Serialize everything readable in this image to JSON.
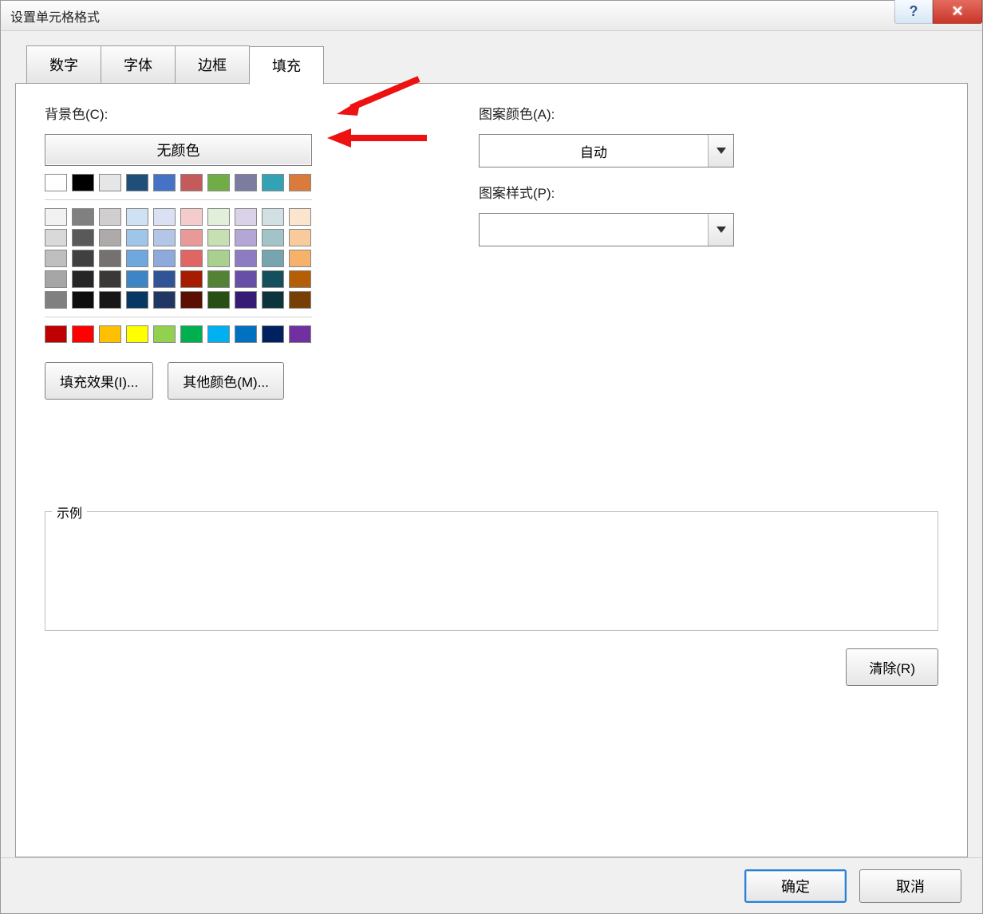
{
  "window": {
    "title": "设置单元格格式"
  },
  "controls": {
    "help_tooltip": "帮助",
    "close_tooltip": "关闭"
  },
  "tabs": [
    {
      "label": "数字",
      "active": false
    },
    {
      "label": "字体",
      "active": false
    },
    {
      "label": "边框",
      "active": false
    },
    {
      "label": "填充",
      "active": true
    }
  ],
  "background": {
    "label": "背景色(C):",
    "no_color_label": "无颜色",
    "theme_row": [
      "#ffffff",
      "#000000",
      "#e7e6e6",
      "#1f4e79",
      "#4472c4",
      "#c55a5a",
      "#70ad47",
      "#7c7ca0",
      "#33a2b5",
      "#d97b3b"
    ],
    "tints": [
      [
        "#f2f2f2",
        "#808080",
        "#d0cece",
        "#cfe2f3",
        "#d9e1f2",
        "#f4cccc",
        "#e2efda",
        "#d9d2e9",
        "#d0e0e3",
        "#fce5cd"
      ],
      [
        "#d9d9d9",
        "#595959",
        "#aeaaaa",
        "#9fc5e8",
        "#b4c6e7",
        "#ea9999",
        "#c6e0b4",
        "#b4a7d6",
        "#a2c4c9",
        "#f9cb9c"
      ],
      [
        "#bfbfbf",
        "#404040",
        "#757171",
        "#6fa8dc",
        "#8ea9db",
        "#e06666",
        "#a9d08e",
        "#8e7cc3",
        "#76a5af",
        "#f6b26b"
      ],
      [
        "#a6a6a6",
        "#262626",
        "#3b3838",
        "#3d85c6",
        "#305496",
        "#a61c00",
        "#548235",
        "#674ea7",
        "#134f5c",
        "#b45f06"
      ],
      [
        "#808080",
        "#0d0d0d",
        "#171717",
        "#073763",
        "#203764",
        "#5b0f00",
        "#274e13",
        "#351c75",
        "#0c343d",
        "#783f04"
      ]
    ],
    "standard_row": [
      "#c00000",
      "#ff0000",
      "#ffc000",
      "#ffff00",
      "#92d050",
      "#00b050",
      "#00b0f0",
      "#0070c0",
      "#002060",
      "#7030a0"
    ],
    "fill_effects_label": "填充效果(I)...",
    "more_colors_label": "其他颜色(M)..."
  },
  "pattern": {
    "color_label": "图案颜色(A):",
    "color_value": "自动",
    "style_label": "图案样式(P):",
    "style_value": ""
  },
  "preview": {
    "label": "示例"
  },
  "actions": {
    "clear": "清除(R)",
    "ok": "确定",
    "cancel": "取消"
  }
}
